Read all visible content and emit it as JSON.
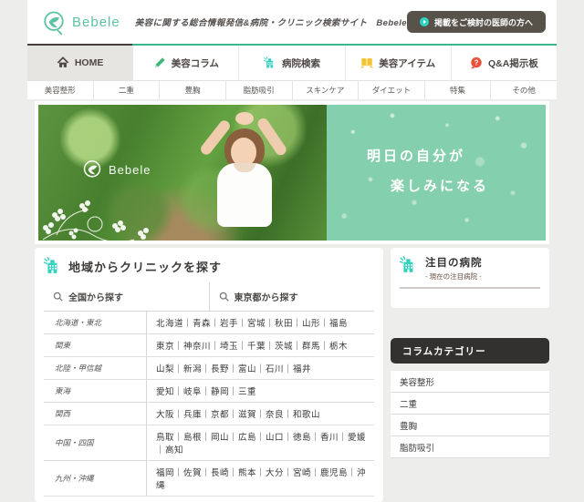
{
  "header": {
    "logo_text": "Bebele",
    "tagline": "美容に関する総合情報発信&病院・クリニック検索サイト　Bebele",
    "doctor_button_label": "掲載をご検討の医師の方へ"
  },
  "nav": {
    "items": [
      {
        "label": "HOME",
        "icon": "home-icon",
        "active": true
      },
      {
        "label": "美容コラム",
        "icon": "pencil-icon"
      },
      {
        "label": "病院検索",
        "icon": "hospital-icon"
      },
      {
        "label": "美容アイテム",
        "icon": "book-icon"
      },
      {
        "label": "Q&A掲示板",
        "icon": "question-bubble-icon"
      }
    ],
    "qa_glyph": "?"
  },
  "subnav": {
    "items": [
      "美容整形",
      "二重",
      "豊胸",
      "脂肪吸引",
      "スキンケア",
      "ダイエット",
      "特集",
      "その他"
    ]
  },
  "hero": {
    "logo_text": "Bebele",
    "catch_line1": "明日の自分が",
    "catch_line2": "楽しみになる"
  },
  "clinic_search": {
    "title": "地域からクリニックを探す",
    "tabs": [
      "全国から探す",
      "東京都から探す"
    ],
    "regions": [
      {
        "area": "北海道・東北",
        "prefs": "北海道｜青森｜岩手｜宮城｜秋田｜山形｜福島"
      },
      {
        "area": "関東",
        "prefs": "東京｜神奈川｜埼玉｜千葉｜茨城｜群馬｜栃木"
      },
      {
        "area": "北陸・甲信越",
        "prefs": "山梨｜新潟｜長野｜富山｜石川｜福井"
      },
      {
        "area": "東海",
        "prefs": "愛知｜岐阜｜静岡｜三重"
      },
      {
        "area": "関西",
        "prefs": "大阪｜兵庫｜京都｜滋賀｜奈良｜和歌山"
      },
      {
        "area": "中国・四国",
        "prefs": "鳥取｜島根｜岡山｜広島｜山口｜徳島｜香川｜愛媛｜高知"
      },
      {
        "area": "九州・沖縄",
        "prefs": "福岡｜佐賀｜長崎｜熊本｜大分｜宮崎｜鹿児島｜沖縄"
      }
    ]
  },
  "sidebar": {
    "featured": {
      "title": "注目の病院",
      "subtitle": "- 現在の注目病院 -"
    },
    "column_categories": {
      "title": "コラムカテゴリー",
      "items": [
        "美容整形",
        "二重",
        "豊胸",
        "脂肪吸引"
      ]
    }
  },
  "colors": {
    "brand_teal": "#5cc2a2",
    "nav_green": "#3db489",
    "hero_panel_green": "#84cfae",
    "hospital_icon_teal": "#2fd0bd",
    "pencil_green": "#3cb878",
    "book_yellow": "#f5c232",
    "qa_red": "#e8503a",
    "button_dark": "#57524a",
    "category_header_dark": "#333130",
    "page_background": "#ededec"
  }
}
